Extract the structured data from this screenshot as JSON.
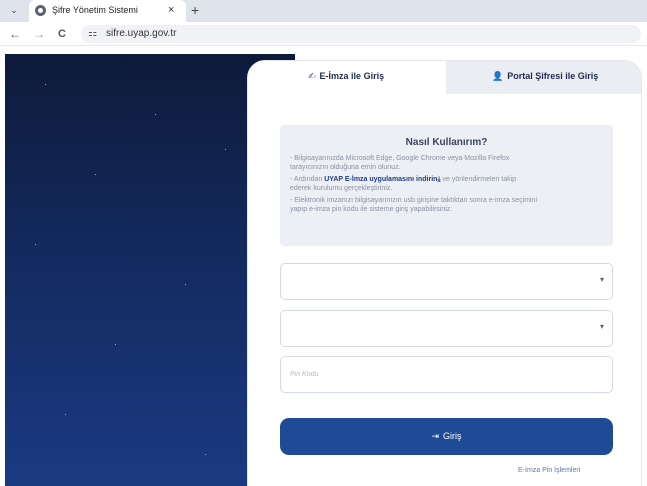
{
  "browser": {
    "tab_title": "Şifre Yönetim Sistemi",
    "close_glyph": "×",
    "new_tab_glyph": "+",
    "tab_list_glyph": "⌄",
    "back_glyph": "←",
    "forward_glyph": "→",
    "reload_glyph": "C",
    "site_info_glyph": "⚏",
    "url": "sifre.uyap.gov.tr"
  },
  "login_tabs": {
    "eimza": {
      "label": "E-İmza ile Giriş",
      "icon": "signature-icon",
      "icon_glyph": "✍",
      "active": true
    },
    "portal": {
      "label": "Portal Şifresi ile Giriş",
      "icon": "user-lock-icon",
      "icon_glyph": "👤",
      "active": false
    }
  },
  "info": {
    "title": "Nasıl Kullanırım?",
    "line1": "- Bilgisayarınızda Microsoft Edge, Google Chrome veya Mozilla Firefox",
    "line2": "tarayıcınızın olduğuna emin olunuz.",
    "line3_pre": "- Ardından ",
    "line3_strong": "UYAP E-İmza uygulamasını indirin",
    "line3_icon": "⤓",
    "line3_post": " ve yönlendirmeleri takip",
    "line4": "ederek kurulumu gerçekleştiriniz.",
    "line5": "- Elektronik imzanızı bilgisayarınızın usb girişine taktıktan sonra e-imza seçimini",
    "line6": "yapıp e-imza pin kodu ile sisteme giriş yapabilirsiniz."
  },
  "form": {
    "select1_value": "",
    "select2_value": "",
    "caret_glyph": "▾",
    "pin_placeholder": "Pin Kodu",
    "pin_value": "",
    "submit_label": "Giriş",
    "submit_icon_glyph": "⇥",
    "pin_link": "E-İmza Pin İşlemleri"
  },
  "colors": {
    "accent": "#1e4a96",
    "background_top": "#0e1a39",
    "background_bottom": "#1a3a82"
  }
}
